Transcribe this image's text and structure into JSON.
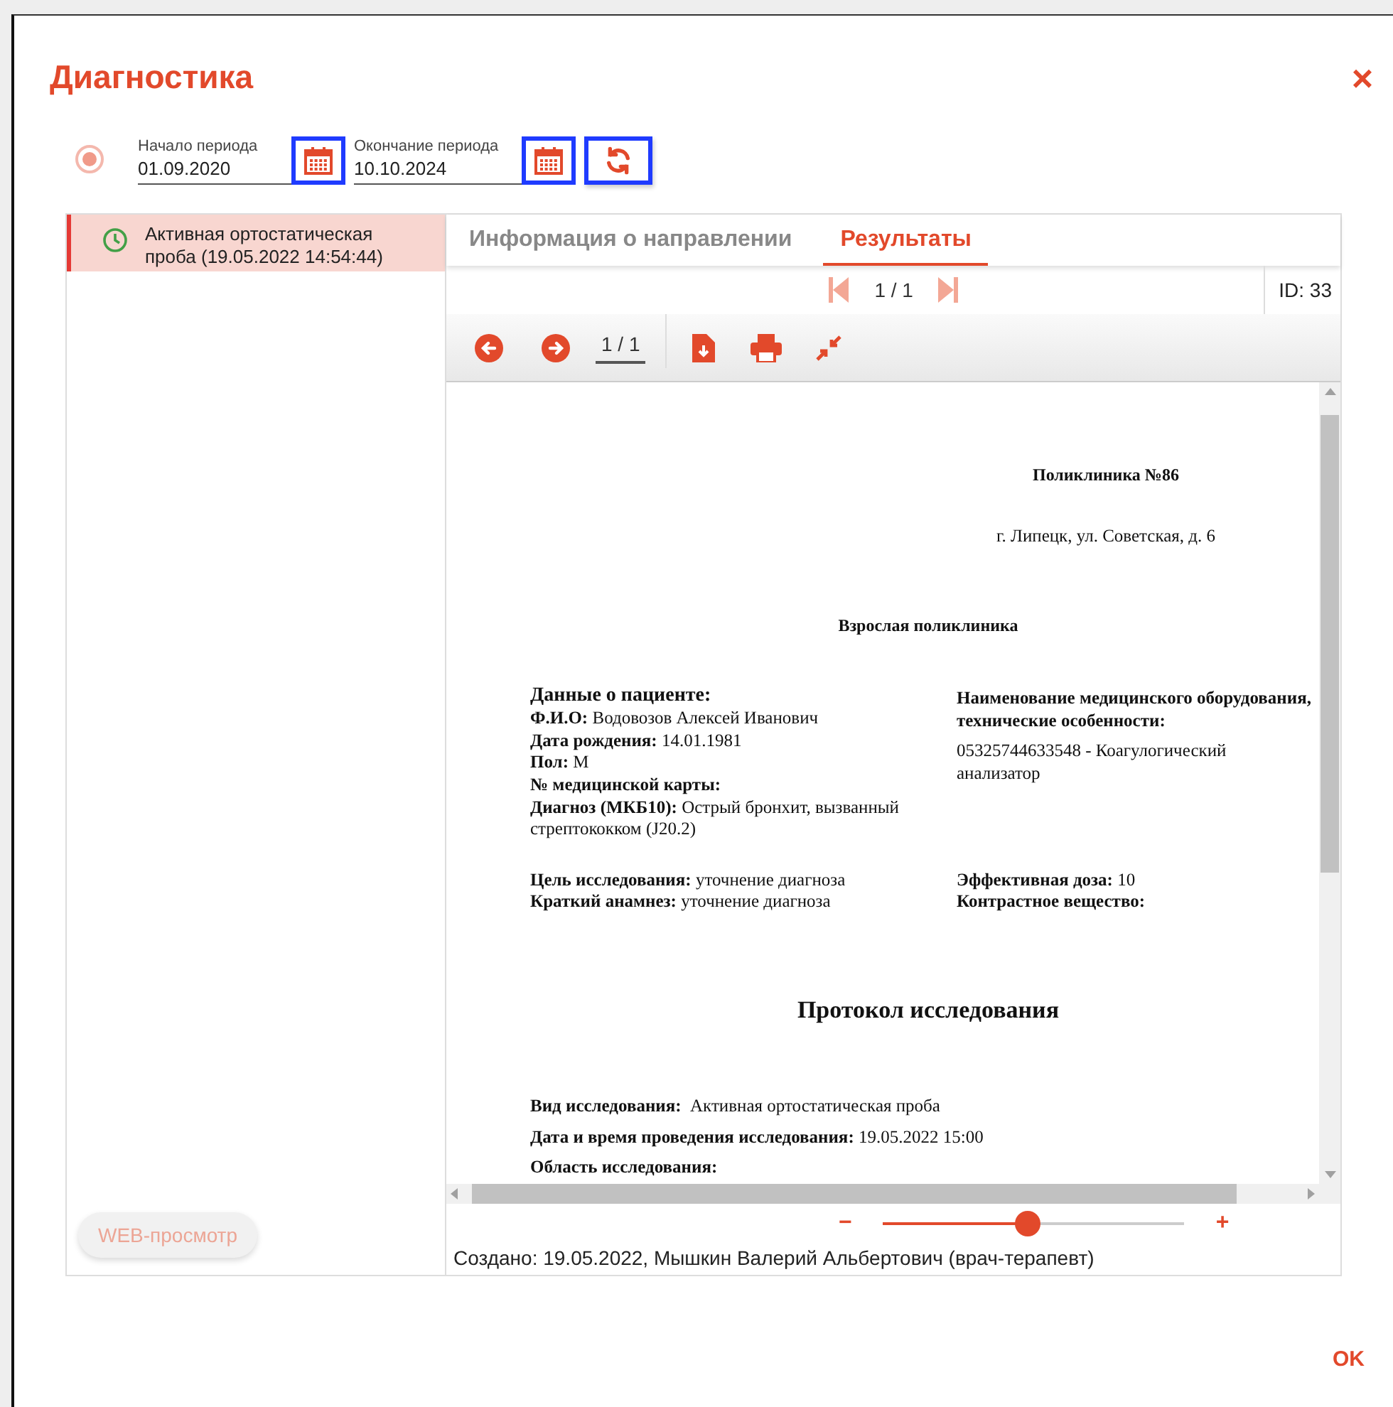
{
  "window": {
    "title": "Диагностика",
    "close": "×"
  },
  "period": {
    "radio_selected": true,
    "start": {
      "label": "Начало периода",
      "value": "01.09.2020",
      "highlighted": true
    },
    "end": {
      "label": "Окончание периода",
      "value": "10.10.2024",
      "highlighted": true
    },
    "refresh_highlighted": true
  },
  "studies": [
    {
      "text": "Активная ортостатическая проба (19.05.2022 14:54:44)",
      "selected": true
    }
  ],
  "web_button": {
    "label": "WEB-просмотр",
    "disabled": true
  },
  "tabs": [
    {
      "label": "Информация о направлении",
      "selected": false
    },
    {
      "label": "Результаты",
      "selected": true
    }
  ],
  "pager": {
    "text": "1 / 1",
    "id": "ID: 33"
  },
  "viewer": {
    "page": "1 / 1"
  },
  "document": {
    "org": "Поликлиника №86",
    "address": "г. Липецк, ул. Советская, д. 6",
    "department": "Взрослая поликлиника",
    "patient_heading": "Данные о пациенте:",
    "patient_lines": [
      "**Ф.И.О:** Водовозов Алексей Иванович",
      "**Дата рождения:** 14.01.1981",
      "**Пол:** М",
      "**№ медицинской карты:**",
      "**Диагноз (МКБ10):** Острый бронхит, вызванный стрептококком (J20.2)"
    ],
    "equipment_heading": "Наименование медицинского оборудования, технические особенности:",
    "equipment_lines": [
      "05325744633548 - Коагулогический анализатор"
    ],
    "purpose_lines": [
      "**Цель исследования:** уточнение диагноза",
      "**Краткий анамнез:** уточнение диагноза"
    ],
    "dose_lines": [
      "**Эффективная доза:** 10",
      "**Контрастное вещество:**"
    ],
    "protocol_title": "Протокол исследования",
    "protocol_lines": [
      "**Вид исследования:**  Активная ортостатическая проба",
      "**Дата и время проведения исследования:** 19.05.2022 15:00",
      "**Область исследования:**"
    ]
  },
  "zoom": {
    "minus": "−",
    "plus": "+",
    "level": 0.48
  },
  "footer": "Создано: 19.05.2022, Мышкин Валерий Альбертович (врач-терапевт)",
  "ok": "OK"
}
